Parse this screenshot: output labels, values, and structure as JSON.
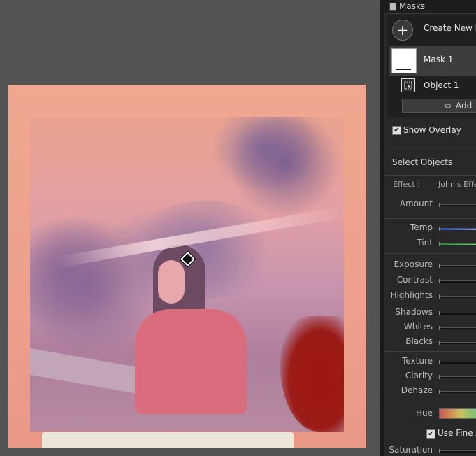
{
  "masks_panel": {
    "title": "Masks",
    "create_new_label": "Create New M",
    "mask_name": "Mask 1",
    "object_label": "Object 1",
    "add_label": "Add",
    "show_overlay_label": "Show Overlay",
    "show_overlay_checked": true
  },
  "select_objects_label": "Select Objects",
  "effect": {
    "label": "Effect :",
    "value": "John's Effe"
  },
  "sliders": {
    "amount": "Amount",
    "temp": "Temp",
    "tint": "Tint",
    "exposure": "Exposure",
    "contrast": "Contrast",
    "highlights": "Highlights",
    "shadows": "Shadows",
    "whites": "Whites",
    "blacks": "Blacks",
    "texture": "Texture",
    "clarity": "Clarity",
    "dehaze": "Dehaze",
    "hue": "Hue",
    "saturation": "Saturation"
  },
  "use_fine_label": "Use Fine A",
  "use_fine_checked": true,
  "icons": {
    "create": "plus-icon",
    "object": "object-select-icon",
    "add": "add-icon",
    "pin": "mask-pin-icon"
  },
  "colors": {
    "mask_overlay": "#a01610",
    "panel_bg": "#282828",
    "canvas_bg": "#535353"
  }
}
